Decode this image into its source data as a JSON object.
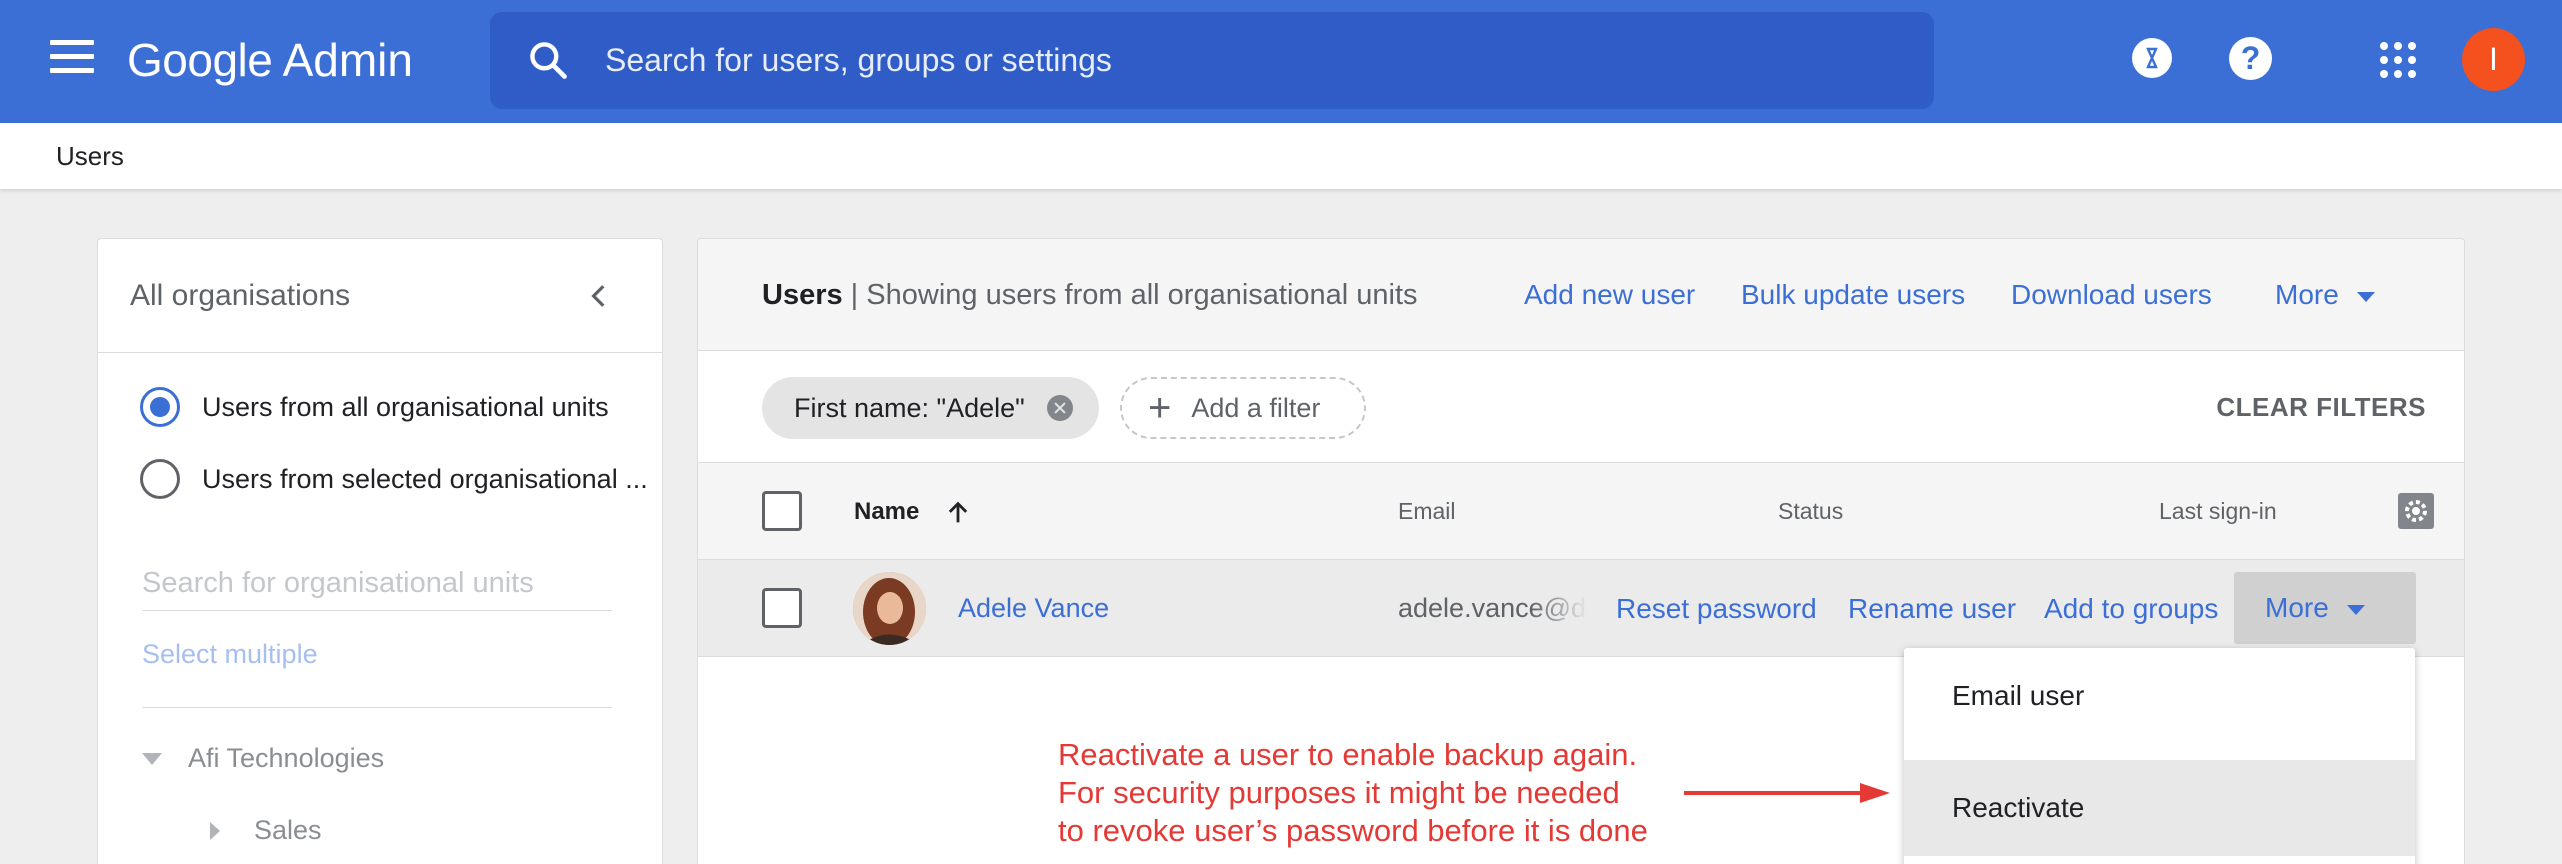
{
  "topbar": {
    "logo_google": "Google",
    "logo_admin": "Admin",
    "search_placeholder": "Search for users, groups or settings",
    "help_glyph": "?",
    "avatar_initial": "I"
  },
  "subheader": {
    "crumb": "Users"
  },
  "left_panel": {
    "title": "All organisations",
    "radio_all": "Users from all organisational units",
    "radio_selected": "Users from selected organisational ...",
    "ou_search_placeholder": "Search for organisational units",
    "select_multiple": "Select multiple",
    "tree": [
      {
        "label": "Afi Technologies"
      },
      {
        "label": "Sales"
      }
    ]
  },
  "main": {
    "title_bold": "Users",
    "title_rest": " | Showing users from all organisational units",
    "actions": [
      "Add new user",
      "Bulk update users",
      "Download users",
      "More"
    ],
    "filter_chip": "First name: \"Adele\"",
    "add_filter": "Add a filter",
    "clear_filters": "CLEAR FILTERS",
    "columns": {
      "name": "Name",
      "email": "Email",
      "status": "Status",
      "last_signin": "Last sign-in"
    },
    "row": {
      "name": "Adele Vance",
      "email": "adele.vance@demo",
      "actions": [
        "Reset password",
        "Rename user",
        "Add to groups"
      ],
      "more": "More"
    },
    "more_menu": [
      "Email user",
      "Reactivate"
    ]
  },
  "annotation": {
    "lines": [
      "Reactivate a user to enable backup again.",
      "For security purposes it might be needed",
      "to revoke user’s password before it is done"
    ]
  },
  "colors": {
    "topbar": "#3b6fd5",
    "link": "#3b6fd5",
    "annotation": "#e53935",
    "avatar": "#f4511e"
  }
}
